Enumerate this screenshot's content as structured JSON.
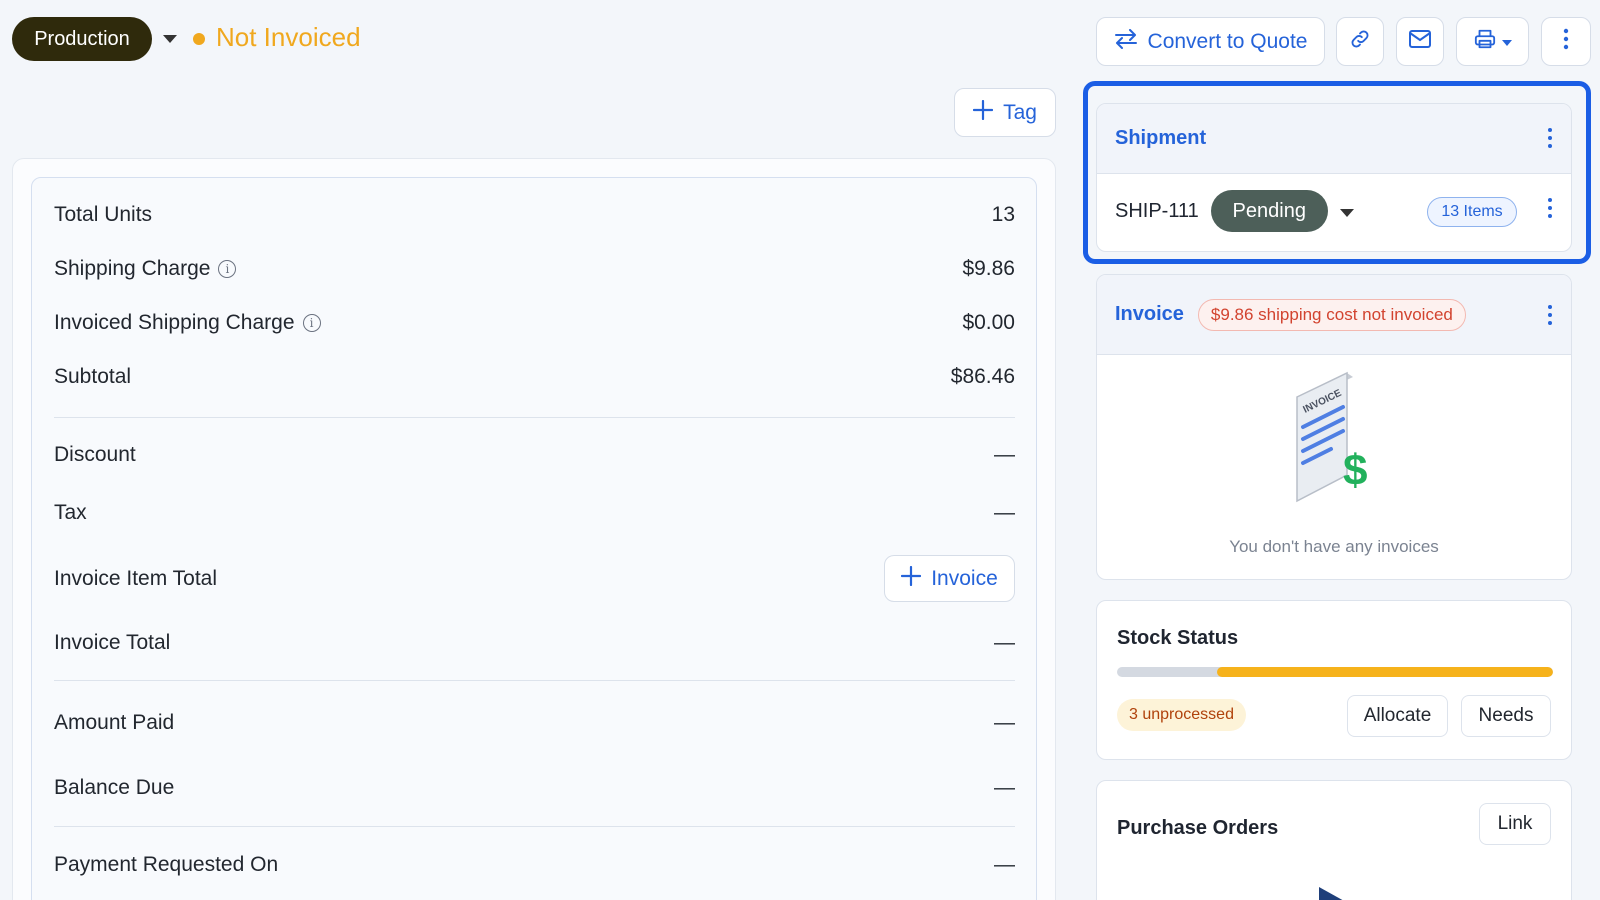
{
  "header": {
    "stage_label": "Production",
    "status_label": "Not Invoiced",
    "convert_label": "Convert to Quote",
    "tag_label": "Tag"
  },
  "summary": {
    "rows": [
      {
        "label": "Total Units",
        "value": "13"
      },
      {
        "label": "Shipping Charge",
        "value": "$9.86"
      },
      {
        "label": "Invoiced Shipping Charge",
        "value": "$0.00"
      },
      {
        "label": "Subtotal",
        "value": "$86.46"
      },
      {
        "label": "Discount",
        "value": "—"
      },
      {
        "label": "Tax",
        "value": "—"
      },
      {
        "label": "Invoice Item Total",
        "value": ""
      },
      {
        "label": "Invoice Total",
        "value": "—"
      },
      {
        "label": "Amount Paid",
        "value": "—"
      },
      {
        "label": "Balance Due",
        "value": "—"
      },
      {
        "label": "Payment Requested On",
        "value": "—"
      }
    ],
    "invoice_button_label": "Invoice"
  },
  "shipment": {
    "title": "Shipment",
    "id": "SHIP-111",
    "status": "Pending",
    "items_label": "13 Items"
  },
  "invoice": {
    "title": "Invoice",
    "warning": "$9.86 shipping cost not invoiced",
    "empty_text": "You don't have any invoices",
    "illustration_text": "INVOICE"
  },
  "stock": {
    "title": "Stock Status",
    "unprocessed_label": "3 unprocessed",
    "allocate_label": "Allocate",
    "needs_label": "Needs",
    "progress_fraction": 0.77
  },
  "purchase_orders": {
    "title": "Purchase Orders",
    "link_label": "Link"
  },
  "colors": {
    "accent": "#2563d9",
    "status_orange": "#f0a81e",
    "highlight": "#1b5ee5",
    "progress": "#f6b21b"
  }
}
